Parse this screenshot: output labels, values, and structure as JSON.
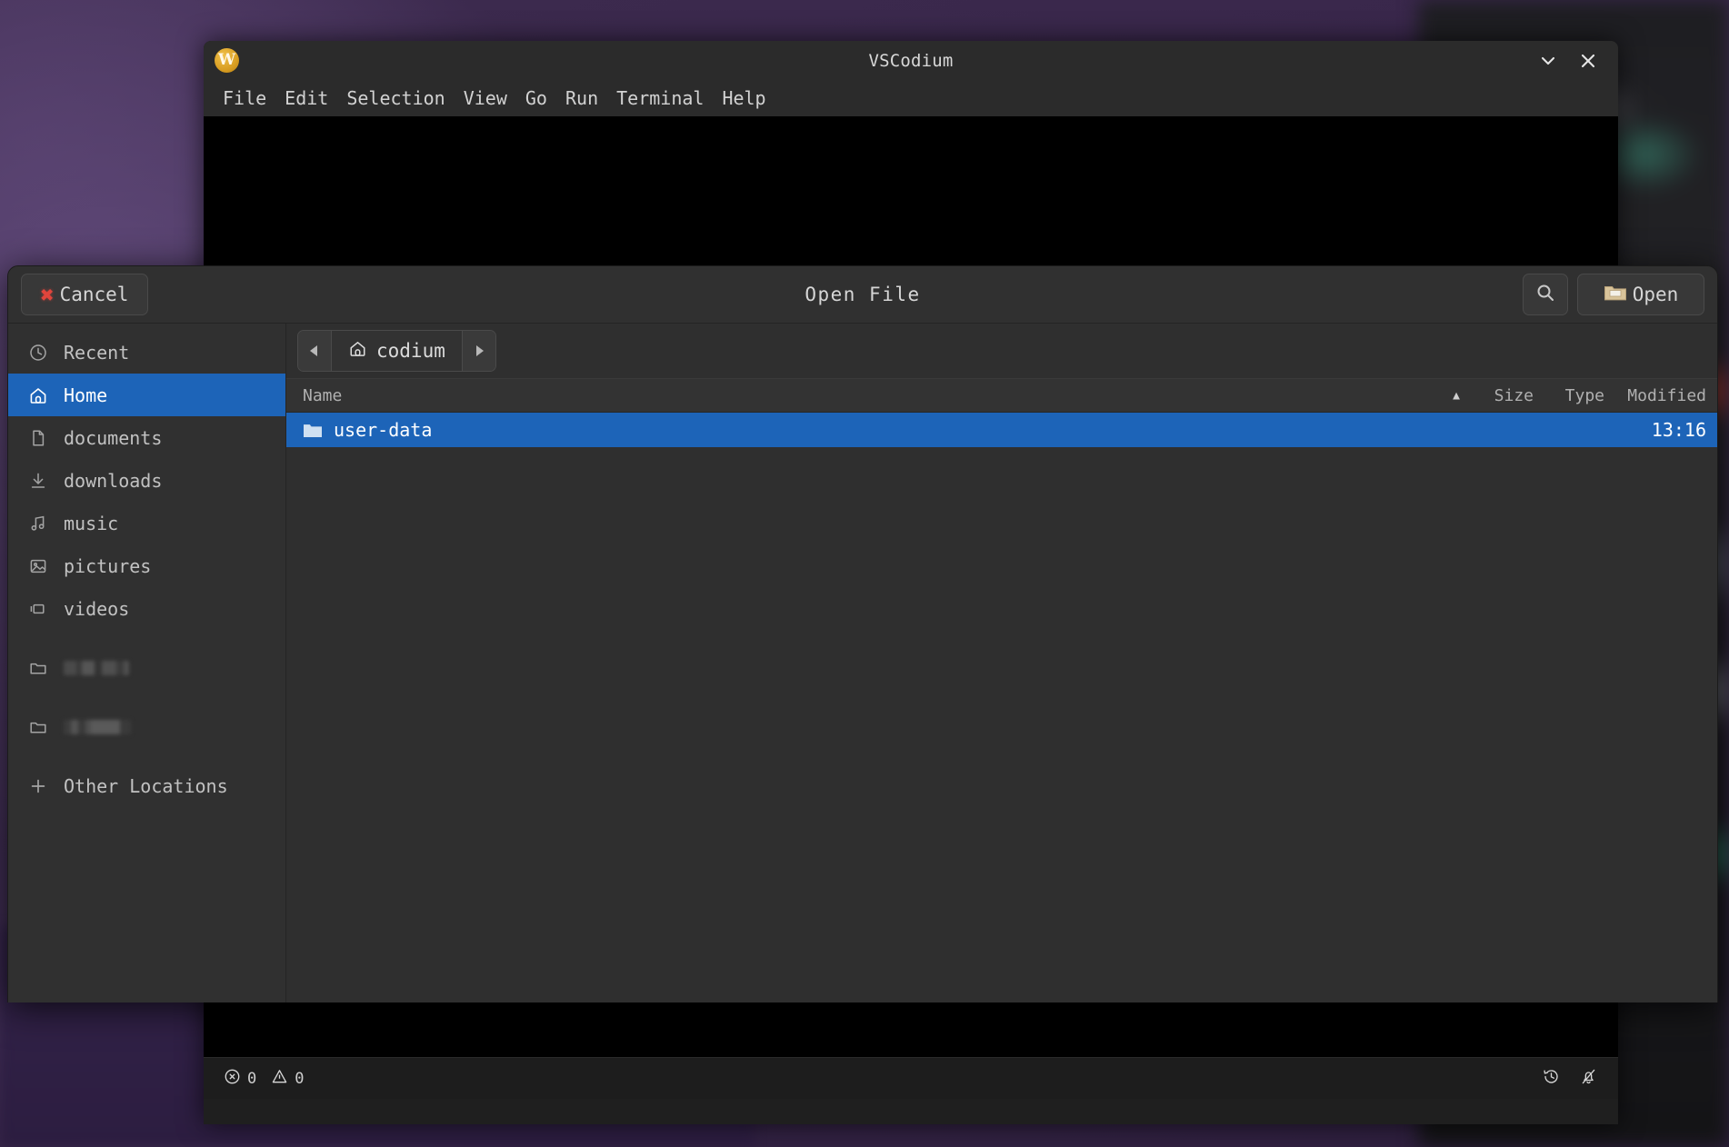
{
  "desktop": {
    "wallpaper_tint": "#3d2b4f"
  },
  "editor_window": {
    "title": "VSCodium",
    "app_icon": "vscodium-w-icon",
    "menu": [
      {
        "label": "File"
      },
      {
        "label": "Edit"
      },
      {
        "label": "Selection"
      },
      {
        "label": "View"
      },
      {
        "label": "Go"
      },
      {
        "label": "Run"
      },
      {
        "label": "Terminal"
      },
      {
        "label": "Help"
      }
    ],
    "window_controls": [
      {
        "name": "minimize",
        "glyph": "chevron-down-icon"
      },
      {
        "name": "close",
        "glyph": "close-icon"
      }
    ],
    "status_bar": {
      "errors_icon": "error-circle-icon",
      "errors_count": "0",
      "warnings_icon": "warning-triangle-icon",
      "warnings_count": "0",
      "right_icons": [
        {
          "name": "history-icon"
        },
        {
          "name": "bell-slash-icon"
        }
      ]
    }
  },
  "dialog": {
    "title": "Open File",
    "cancel_label": "Cancel",
    "cancel_icon": "red-x-icon",
    "search_icon": "search-icon",
    "open_label": "Open",
    "open_icon": "folder-open-icon",
    "sidebar": {
      "items": [
        {
          "label": "Recent",
          "icon": "clock-icon",
          "selected": false,
          "redacted": false
        },
        {
          "label": "Home",
          "icon": "home-icon",
          "selected": true,
          "redacted": false
        },
        {
          "label": "documents",
          "icon": "document-icon",
          "selected": false,
          "redacted": false
        },
        {
          "label": "downloads",
          "icon": "download-icon",
          "selected": false,
          "redacted": false
        },
        {
          "label": "music",
          "icon": "music-note-icon",
          "selected": false,
          "redacted": false
        },
        {
          "label": "pictures",
          "icon": "image-icon",
          "selected": false,
          "redacted": false
        },
        {
          "label": "videos",
          "icon": "video-icon",
          "selected": false,
          "redacted": false
        },
        {
          "label": "",
          "icon": "folder-icon",
          "selected": false,
          "redacted": true
        },
        {
          "label": "",
          "icon": "folder-icon",
          "selected": false,
          "redacted": true
        },
        {
          "label": "Other Locations",
          "icon": "plus-icon",
          "selected": false,
          "redacted": false
        }
      ]
    },
    "pathbar": {
      "back_icon": "caret-left-icon",
      "forward_icon": "caret-right-icon",
      "crumb_icon": "home-icon",
      "crumb_label": "codium"
    },
    "file_list": {
      "columns": {
        "name": "Name",
        "sort_arrow": "▲",
        "size": "Size",
        "type": "Type",
        "modified": "Modified"
      },
      "rows": [
        {
          "name": "user-data",
          "icon": "folder-icon",
          "size": "",
          "type": "",
          "modified": "13:16",
          "selected": true
        }
      ]
    }
  },
  "colors": {
    "selection_blue": "#1d64b8",
    "dialog_bg": "#2f2f2f",
    "sidebar_bg": "#303030",
    "cancel_x_red": "#e0453c",
    "app_icon_gold": "#d99e22"
  }
}
